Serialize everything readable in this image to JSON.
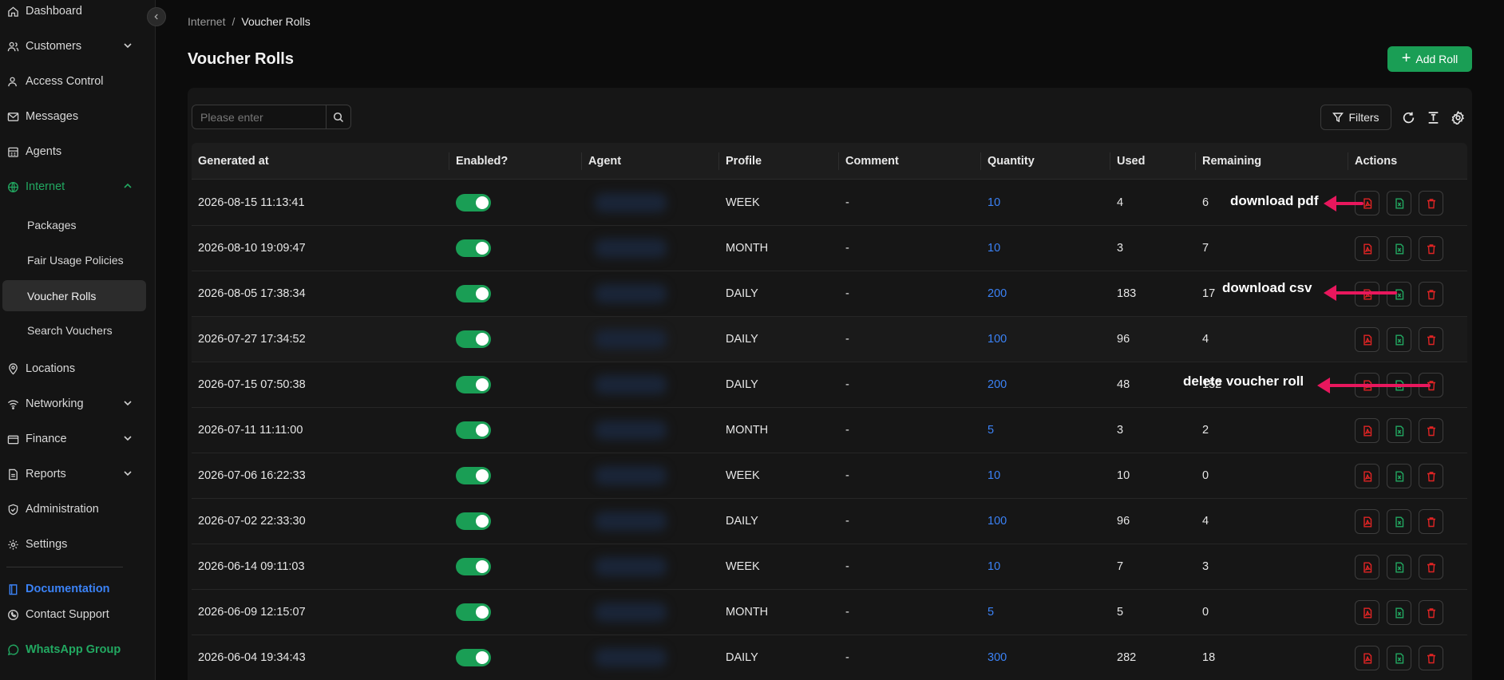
{
  "sidebar": {
    "items": [
      {
        "label": "Dashboard",
        "icon": "home-icon"
      },
      {
        "label": "Customers",
        "icon": "users-icon"
      },
      {
        "label": "Access Control",
        "icon": "user-key-icon"
      },
      {
        "label": "Messages",
        "icon": "mail-icon"
      },
      {
        "label": "Agents",
        "icon": "building-icon"
      },
      {
        "label": "Internet",
        "icon": "globe-icon"
      },
      {
        "label": "Packages"
      },
      {
        "label": "Fair Usage Policies"
      },
      {
        "label": "Voucher Rolls"
      },
      {
        "label": "Search Vouchers"
      },
      {
        "label": "Locations",
        "icon": "pin-icon"
      },
      {
        "label": "Networking",
        "icon": "wifi-icon"
      },
      {
        "label": "Finance",
        "icon": "wallet-icon"
      },
      {
        "label": "Reports",
        "icon": "report-icon"
      },
      {
        "label": "Administration",
        "icon": "shield-icon"
      },
      {
        "label": "Settings",
        "icon": "gear-icon"
      },
      {
        "label": "Documentation",
        "icon": "book-icon"
      },
      {
        "label": "Contact Support",
        "icon": "phone-icon"
      },
      {
        "label": "WhatsApp Group",
        "icon": "whatsapp-icon"
      }
    ]
  },
  "breadcrumb": {
    "parent": "Internet",
    "separator": "/",
    "current": "Voucher Rolls"
  },
  "page": {
    "title": "Voucher Rolls",
    "add_label": "Add Roll"
  },
  "toolbar": {
    "search_placeholder": "Please enter",
    "filters_label": "Filters"
  },
  "table": {
    "headers": [
      "Generated at",
      "Enabled?",
      "Agent",
      "Profile",
      "Comment",
      "Quantity",
      "Used",
      "Remaining",
      "Actions"
    ],
    "rows": [
      {
        "generated": "2026-08-15 11:13:41",
        "enabled": true,
        "profile": "WEEK",
        "comment": "-",
        "quantity": "10",
        "used": "4",
        "remaining": "6"
      },
      {
        "generated": "2026-08-10 19:09:47",
        "enabled": true,
        "profile": "MONTH",
        "comment": "-",
        "quantity": "10",
        "used": "3",
        "remaining": "7"
      },
      {
        "generated": "2026-08-05 17:38:34",
        "enabled": true,
        "profile": "DAILY",
        "comment": "-",
        "quantity": "200",
        "used": "183",
        "remaining": "17"
      },
      {
        "generated": "2026-07-27 17:34:52",
        "enabled": true,
        "profile": "DAILY",
        "comment": "-",
        "quantity": "100",
        "used": "96",
        "remaining": "4"
      },
      {
        "generated": "2026-07-15 07:50:38",
        "enabled": true,
        "profile": "DAILY",
        "comment": "-",
        "quantity": "200",
        "used": "48",
        "remaining": "152"
      },
      {
        "generated": "2026-07-11 11:11:00",
        "enabled": true,
        "profile": "MONTH",
        "comment": "-",
        "quantity": "5",
        "used": "3",
        "remaining": "2"
      },
      {
        "generated": "2026-07-06 16:22:33",
        "enabled": true,
        "profile": "WEEK",
        "comment": "-",
        "quantity": "10",
        "used": "10",
        "remaining": "0"
      },
      {
        "generated": "2026-07-02 22:33:30",
        "enabled": true,
        "profile": "DAILY",
        "comment": "-",
        "quantity": "100",
        "used": "96",
        "remaining": "4"
      },
      {
        "generated": "2026-06-14 09:11:03",
        "enabled": true,
        "profile": "WEEK",
        "comment": "-",
        "quantity": "10",
        "used": "7",
        "remaining": "3"
      },
      {
        "generated": "2026-06-09 12:15:07",
        "enabled": true,
        "profile": "MONTH",
        "comment": "-",
        "quantity": "5",
        "used": "5",
        "remaining": "0"
      },
      {
        "generated": "2026-06-04 19:34:43",
        "enabled": true,
        "profile": "DAILY",
        "comment": "-",
        "quantity": "300",
        "used": "282",
        "remaining": "18"
      }
    ]
  },
  "annotations": {
    "pdf": "download pdf",
    "csv": "download csv",
    "delete": "delete voucher roll"
  },
  "colors": {
    "accent": "#1a9e55",
    "link": "#3b82f6",
    "pdf": "#e02424",
    "csv": "#22a861",
    "delete": "#e02424",
    "annotation_arrow": "#e8175d"
  }
}
